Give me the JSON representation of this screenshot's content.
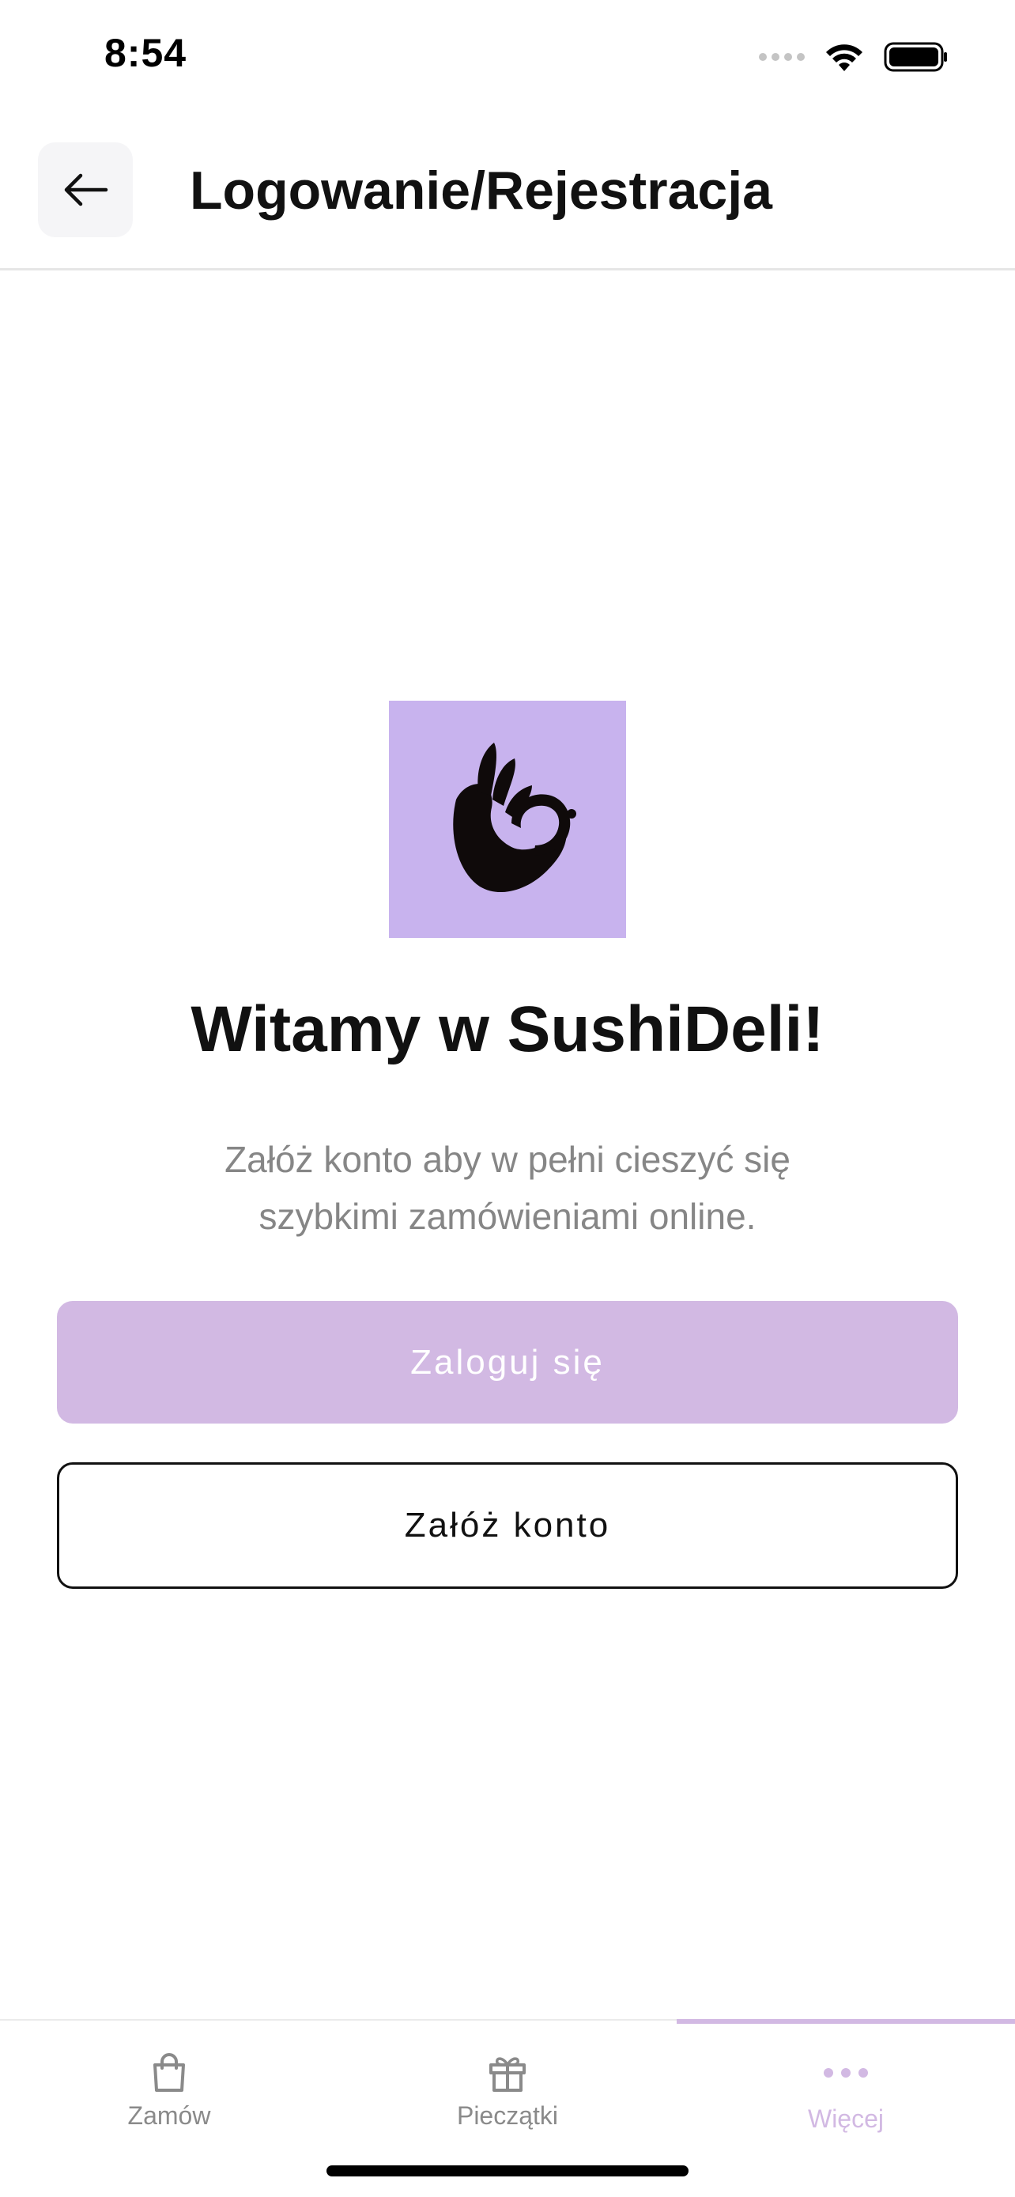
{
  "status_bar": {
    "time": "8:54"
  },
  "header": {
    "title": "Logowanie/Rejestracja"
  },
  "hero": {
    "title": "Witamy w SushiDeli!",
    "subtitle": "Załóż konto aby w pełni cieszyć się szybkimi zamówieniami online."
  },
  "buttons": {
    "login_label": "Zaloguj się",
    "register_label": "Załóż konto"
  },
  "tabs": [
    {
      "label": "Zamów",
      "icon": "shopping-bag-icon",
      "active": false
    },
    {
      "label": "Pieczątki",
      "icon": "gift-icon",
      "active": false
    },
    {
      "label": "Więcej",
      "icon": "more-dots-icon",
      "active": true
    }
  ],
  "colors": {
    "accent": "#d2b9e3",
    "logo_background": "#c8b3ee",
    "text_primary": "#111111",
    "text_secondary": "#868686"
  }
}
